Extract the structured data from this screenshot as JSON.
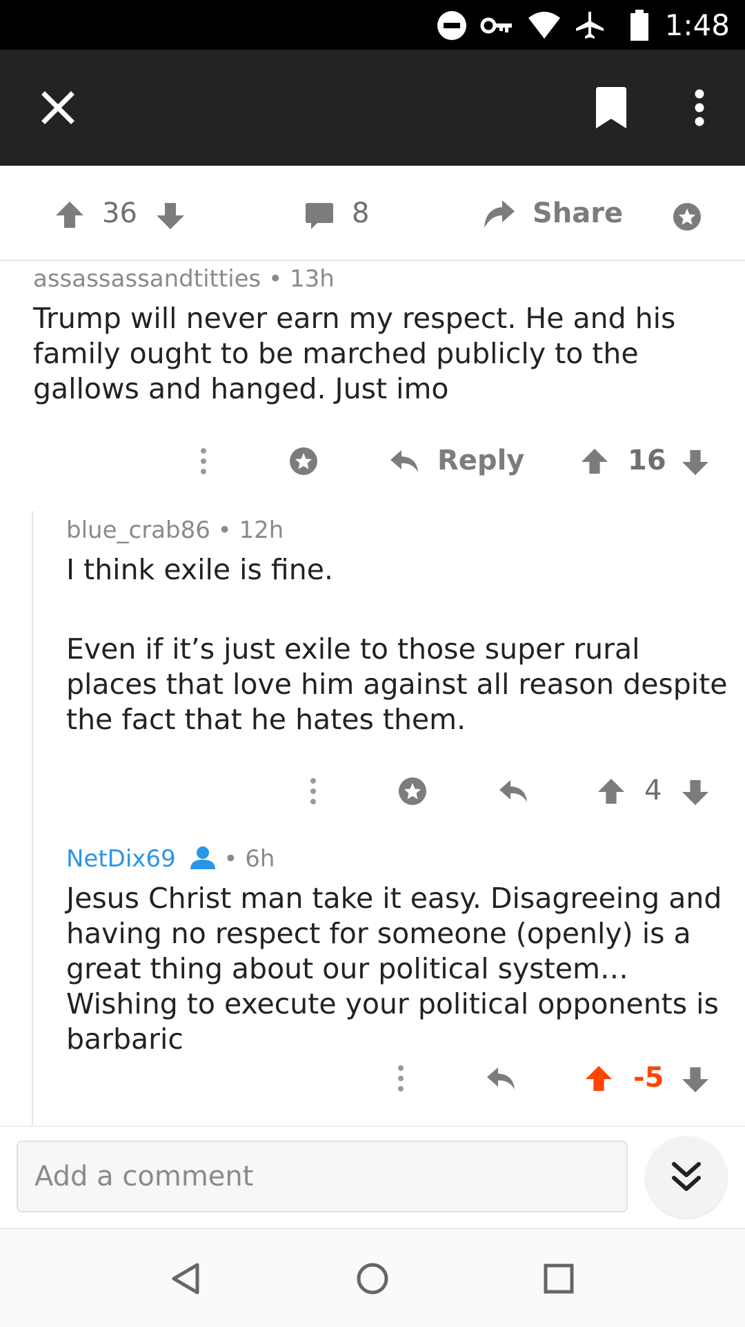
{
  "status_bar": {
    "time": "1:48"
  },
  "post_actions": {
    "upvote_count": "36",
    "comment_count": "8",
    "share_label": "Share"
  },
  "comments": [
    {
      "author": "assassassandtitties",
      "age": "13h",
      "body": [
        "Trump will never earn my respect. He and his family ought to be marched publicly to the gallows and hanged. Just imo"
      ],
      "reply_label": "Reply",
      "score": "16"
    },
    {
      "author": "blue_crab86",
      "age": "12h",
      "body": [
        "I think exile is fine.",
        "Even if it’s just exile to those super rural places that love him against all reason despite the fact that he hates them."
      ],
      "score": "4"
    },
    {
      "author": "NetDix69",
      "age": "6h",
      "body": [
        "Jesus Christ man take it easy. Disagreeing and having no respect for someone (openly) is a great thing about our political system… Wishing to execute your political opponents is barbaric"
      ],
      "score": "-5"
    }
  ],
  "composer": {
    "placeholder": "Add a comment"
  },
  "colors": {
    "toolbar_bg": "#232323",
    "op_username": "#2a95e6",
    "upvoted": "#ff4500",
    "icon_gray": "#7c7c7c"
  },
  "icons": {
    "toolbar": [
      "close-icon",
      "bookmark-icon",
      "more-vertical-icon"
    ],
    "actions": [
      "upvote-icon",
      "downvote-icon",
      "comment-bubble-icon",
      "share-arrow-icon",
      "award-icon",
      "reply-arrow-icon",
      "kebab-icon",
      "op-person-icon",
      "chevron-double-down-icon"
    ],
    "navbar": [
      "back-icon",
      "home-icon",
      "recents-icon"
    ]
  }
}
